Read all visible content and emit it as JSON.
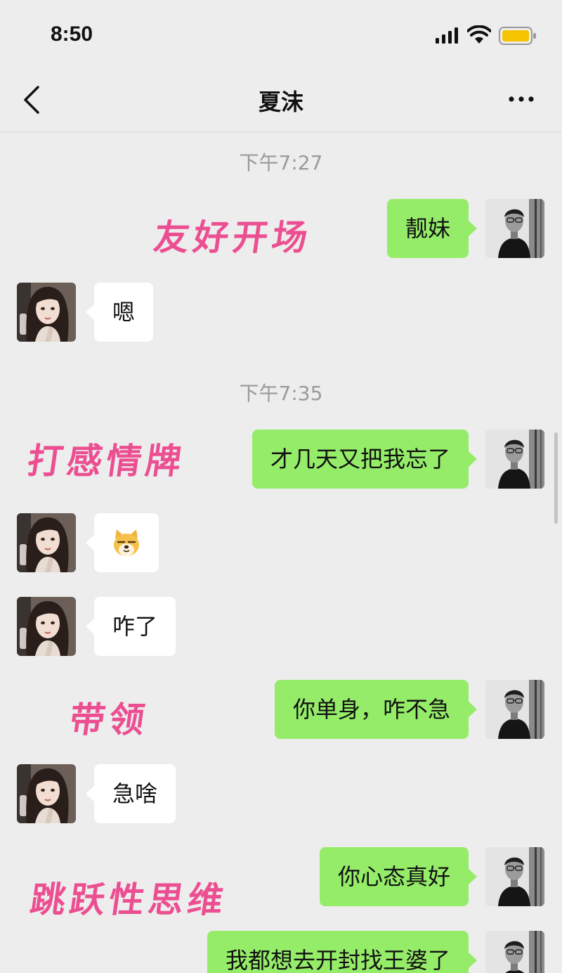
{
  "status_bar": {
    "time": "8:50"
  },
  "header": {
    "title": "夏沫"
  },
  "timestamps": [
    "下午7:27",
    "下午7:35"
  ],
  "annotations": [
    "友好开场",
    "打感情牌",
    "带领",
    "跳跃性思维"
  ],
  "messages": [
    {
      "side": "out",
      "text": "靓妹"
    },
    {
      "side": "in",
      "text": "嗯"
    },
    {
      "side": "out",
      "text": "才几天又把我忘了"
    },
    {
      "side": "in",
      "emoji": "doge-emoji"
    },
    {
      "side": "in",
      "text": "咋了"
    },
    {
      "side": "out",
      "text": "你单身，咋不急"
    },
    {
      "side": "in",
      "text": "急啥"
    },
    {
      "side": "out",
      "text": "你心态真好"
    },
    {
      "side": "out",
      "text": "我都想去开封找王婆了"
    }
  ],
  "colors": {
    "background": "#ededed",
    "outgoing_bubble": "#95ec69",
    "incoming_bubble": "#ffffff",
    "annotation_pink": "#ec4f91",
    "timestamp_gray": "#9a9a9a"
  },
  "icons": [
    "back-icon",
    "more-icon",
    "signal-icon",
    "wifi-icon",
    "battery-icon"
  ]
}
